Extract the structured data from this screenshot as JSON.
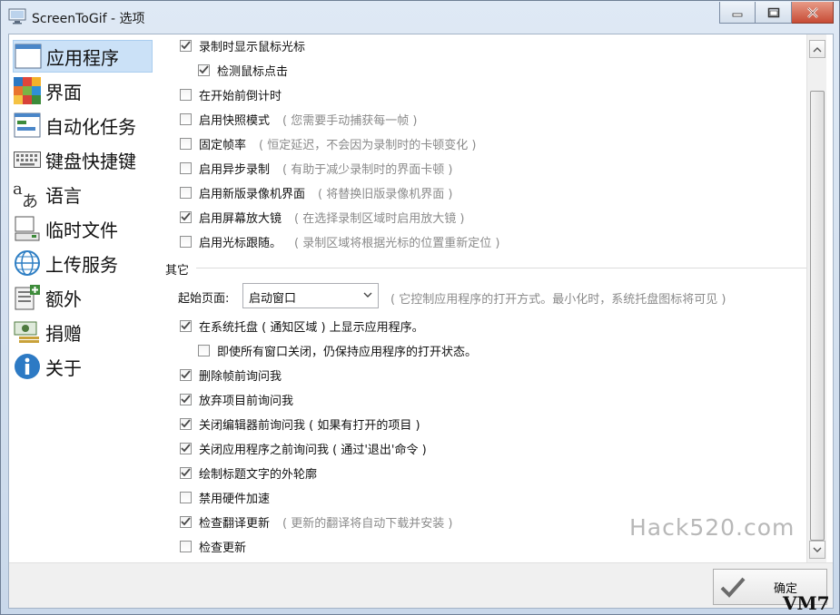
{
  "window": {
    "title": "ScreenToGif - 选项"
  },
  "sidebar": {
    "items": [
      {
        "label": "应用程序",
        "icon": "application-window-icon",
        "selected": true
      },
      {
        "label": "界面",
        "icon": "color-palette-icon",
        "selected": false
      },
      {
        "label": "自动化任务",
        "icon": "task-list-icon",
        "selected": false
      },
      {
        "label": "键盘快捷键",
        "icon": "keyboard-icon",
        "selected": false
      },
      {
        "label": "语言",
        "icon": "language-icon",
        "selected": false
      },
      {
        "label": "临时文件",
        "icon": "temp-files-icon",
        "selected": false
      },
      {
        "label": "上传服务",
        "icon": "globe-icon",
        "selected": false
      },
      {
        "label": "额外",
        "icon": "extras-icon",
        "selected": false
      },
      {
        "label": "捐赠",
        "icon": "donate-money-icon",
        "selected": false
      },
      {
        "label": "关于",
        "icon": "info-icon",
        "selected": false
      }
    ]
  },
  "recorder_options": [
    {
      "label": "录制时显示鼠标光标",
      "hint": "",
      "checked": true,
      "indent": 0
    },
    {
      "label": "检测鼠标点击",
      "hint": "",
      "checked": true,
      "indent": 1
    },
    {
      "label": "在开始前倒计时",
      "hint": "",
      "checked": false,
      "indent": 0
    },
    {
      "label": "启用快照模式",
      "hint": "( 您需要手动捕获每一帧 )",
      "checked": false,
      "indent": 0
    },
    {
      "label": "固定帧率",
      "hint": "( 恒定延迟，不会因为录制时的卡顿变化 )",
      "checked": false,
      "indent": 0
    },
    {
      "label": "启用异步录制",
      "hint": "( 有助于减少录制时的界面卡顿 )",
      "checked": false,
      "indent": 0
    },
    {
      "label": "启用新版录像机界面",
      "hint": "( 将替换旧版录像机界面 )",
      "checked": false,
      "indent": 0
    },
    {
      "label": "启用屏幕放大镜",
      "hint": "( 在选择录制区域时启用放大镜 )",
      "checked": true,
      "indent": 0
    },
    {
      "label": "启用光标跟随。",
      "hint": "( 录制区域将根据光标的位置重新定位 )",
      "checked": false,
      "indent": 0
    }
  ],
  "other_section": {
    "title": "其它",
    "start_page_label": "起始页面:",
    "start_page_value": "启动窗口",
    "start_page_hint": "( 它控制应用程序的打开方式。最小化时，系统托盘图标将可见 )"
  },
  "other_options": [
    {
      "label": "在系统托盘 ( 通知区域 ) 上显示应用程序。",
      "hint": "",
      "checked": true,
      "indent": 0
    },
    {
      "label": "即使所有窗口关闭，仍保持应用程序的打开状态。",
      "hint": "",
      "checked": false,
      "indent": 1
    },
    {
      "label": "删除帧前询问我",
      "hint": "",
      "checked": true,
      "indent": 0
    },
    {
      "label": "放弃项目前询问我",
      "hint": "",
      "checked": true,
      "indent": 0
    },
    {
      "label": "关闭编辑器前询问我 ( 如果有打开的项目 )",
      "hint": "",
      "checked": true,
      "indent": 0
    },
    {
      "label": "关闭应用程序之前询问我 ( 通过'退出'命令 )",
      "hint": "",
      "checked": true,
      "indent": 0
    },
    {
      "label": "绘制标题文字的外轮廓",
      "hint": "",
      "checked": true,
      "indent": 0
    },
    {
      "label": "禁用硬件加速",
      "hint": "",
      "checked": false,
      "indent": 0
    },
    {
      "label": "检查翻译更新",
      "hint": "( 更新的翻译将自动下载并安装 )",
      "checked": true,
      "indent": 0
    },
    {
      "label": "检查更新",
      "hint": "",
      "checked": false,
      "indent": 0
    }
  ],
  "footer": {
    "ok_label": "确定"
  },
  "watermark": "Hack520.com",
  "badge": "VM7"
}
